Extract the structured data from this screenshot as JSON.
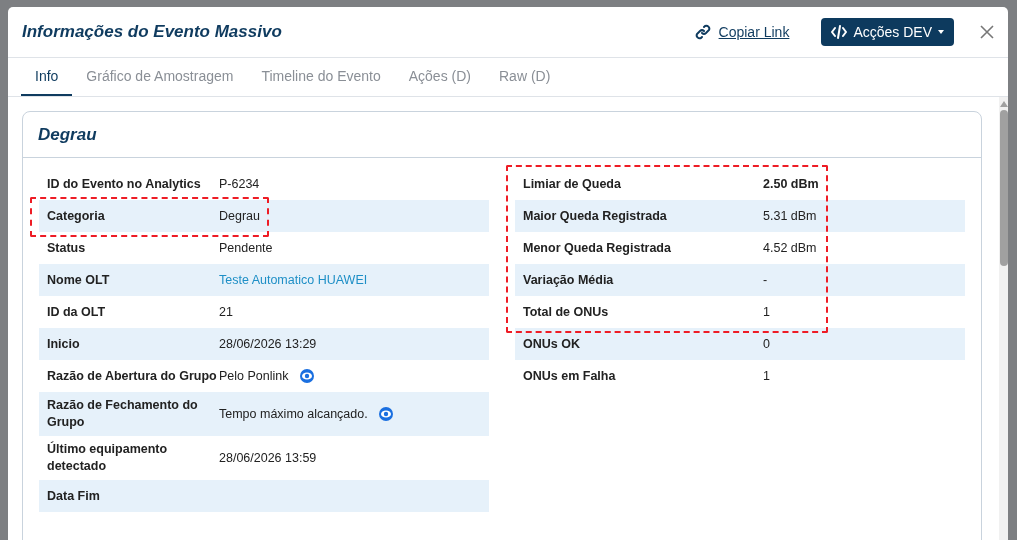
{
  "modal": {
    "title": "Informações do Evento Massivo",
    "copy_link": "Copiar Link",
    "dev_button": "Acções DEV"
  },
  "tabs": [
    {
      "label": "Info",
      "selected": true
    },
    {
      "label": "Gráfico de Amostragem",
      "selected": false
    },
    {
      "label": "Timeline do Evento",
      "selected": false
    },
    {
      "label": "Ações (D)",
      "selected": false
    },
    {
      "label": "Raw (D)",
      "selected": false
    }
  ],
  "card": {
    "title": "Degrau",
    "left_rows": [
      {
        "label": "ID do Evento no Analytics",
        "value": "P-6234",
        "kind": "text",
        "info_icon": false,
        "highlighted": false
      },
      {
        "label": "Categoria",
        "value": "Degrau",
        "kind": "text",
        "info_icon": false,
        "highlighted": true
      },
      {
        "label": "Status",
        "value": "Pendente",
        "kind": "text",
        "info_icon": false,
        "highlighted": false
      },
      {
        "label": "Nome OLT",
        "value": "Teste Automatico HUAWEI",
        "kind": "link",
        "info_icon": false,
        "highlighted": false
      },
      {
        "label": "ID da OLT",
        "value": "21",
        "kind": "text",
        "info_icon": false,
        "highlighted": false
      },
      {
        "label": "Inicio",
        "value": "28/06/2026 13:29",
        "kind": "text",
        "info_icon": false,
        "highlighted": false
      },
      {
        "label": "Razão de Abertura do Grupo",
        "value": "Pelo Ponlink",
        "kind": "text",
        "info_icon": true,
        "highlighted": false
      },
      {
        "label": "Razão de Fechamento do Grupo",
        "value": "Tempo máximo alcançado.",
        "kind": "text",
        "info_icon": true,
        "highlighted": false
      },
      {
        "label": "Último equipamento detectado",
        "value": "28/06/2026 13:59",
        "kind": "text",
        "info_icon": false,
        "highlighted": false
      },
      {
        "label": "Data Fim",
        "info_icon": false,
        "highlighted": false
      }
    ],
    "right_rows": [
      {
        "label": "Limiar de Queda",
        "value": "2.50 dBm",
        "bold": true,
        "highlighted": true
      },
      {
        "label": "Maior Queda Registrada",
        "value": "5.31 dBm",
        "bold": false,
        "highlighted": true
      },
      {
        "label": "Menor Queda Registrada",
        "value": "4.52 dBm",
        "bold": false,
        "highlighted": true
      },
      {
        "label": "Variação Média",
        "value": "-",
        "bold": false,
        "highlighted": true
      },
      {
        "label": "Total de ONUs",
        "value": "1",
        "bold": false,
        "highlighted": true
      },
      {
        "label": "ONUs OK",
        "value": "0",
        "bold": false,
        "highlighted": false
      },
      {
        "label": "ONUs em Falha",
        "value": "1",
        "bold": false,
        "highlighted": false
      }
    ]
  }
}
